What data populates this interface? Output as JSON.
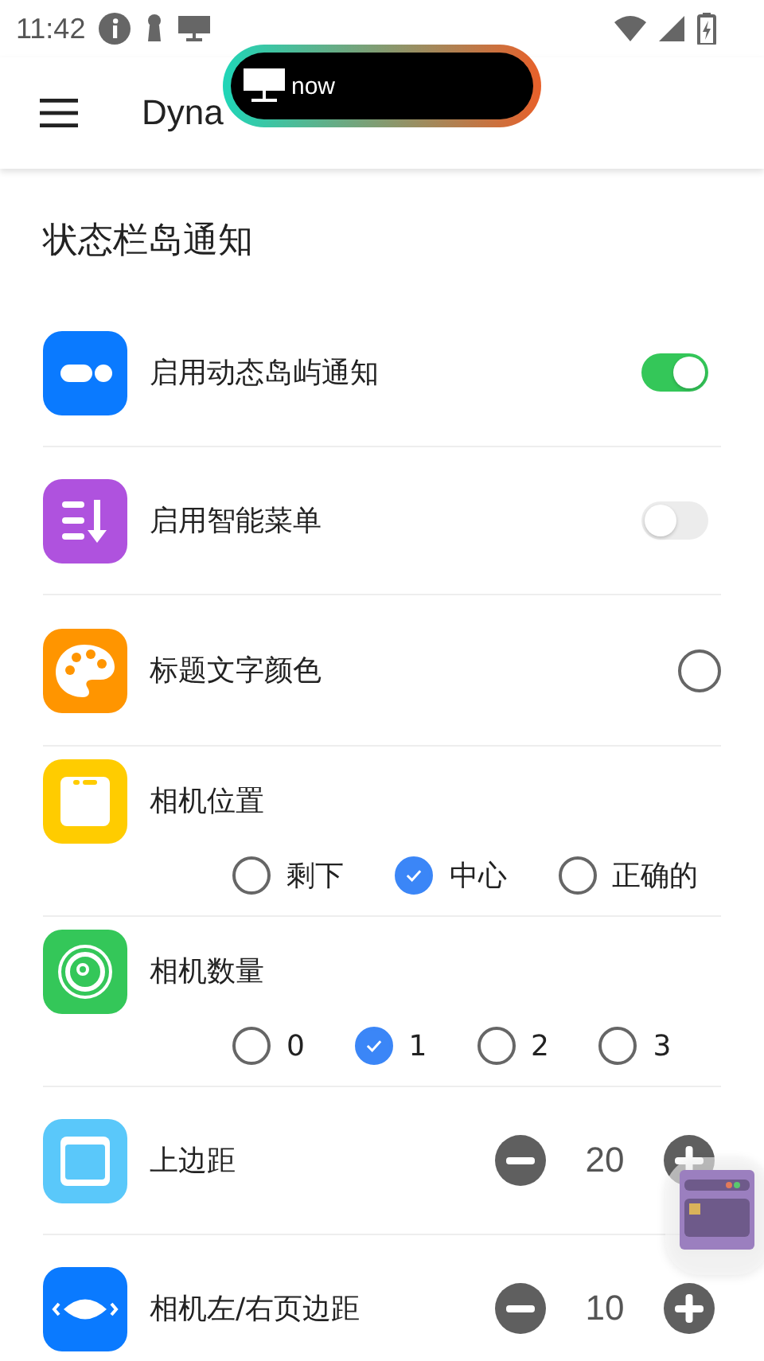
{
  "status_bar": {
    "time": "11:42"
  },
  "island": {
    "text": "now"
  },
  "app_bar": {
    "title": "Dyna"
  },
  "section": {
    "title": "状态栏岛通知"
  },
  "rows": [
    {
      "kind": "switch",
      "label": "启用动态岛屿通知",
      "color": "#0a7aff",
      "on": true
    },
    {
      "kind": "switch",
      "label": "启用智能菜单",
      "color": "#af52de",
      "on": false
    },
    {
      "kind": "check",
      "label": "标题文字颜色",
      "color": "#ff9500",
      "checked": false
    },
    {
      "kind": "radio",
      "label": "相机位置",
      "color": "#ffcc00",
      "options": [
        {
          "label": "剩下",
          "selected": false
        },
        {
          "label": "中心",
          "selected": true
        },
        {
          "label": "正确的",
          "selected": false
        }
      ]
    },
    {
      "kind": "radio",
      "label": "相机数量",
      "color": "#34c759",
      "options": [
        {
          "label": "0",
          "selected": false
        },
        {
          "label": "1",
          "selected": true
        },
        {
          "label": "2",
          "selected": false
        },
        {
          "label": "3",
          "selected": false
        }
      ]
    },
    {
      "kind": "stepper",
      "label": "上边距",
      "color": "#5ac8fa",
      "value": "20"
    },
    {
      "kind": "stepper",
      "label": "相机左/右页边距",
      "color": "#0a7aff",
      "value": "10"
    }
  ]
}
